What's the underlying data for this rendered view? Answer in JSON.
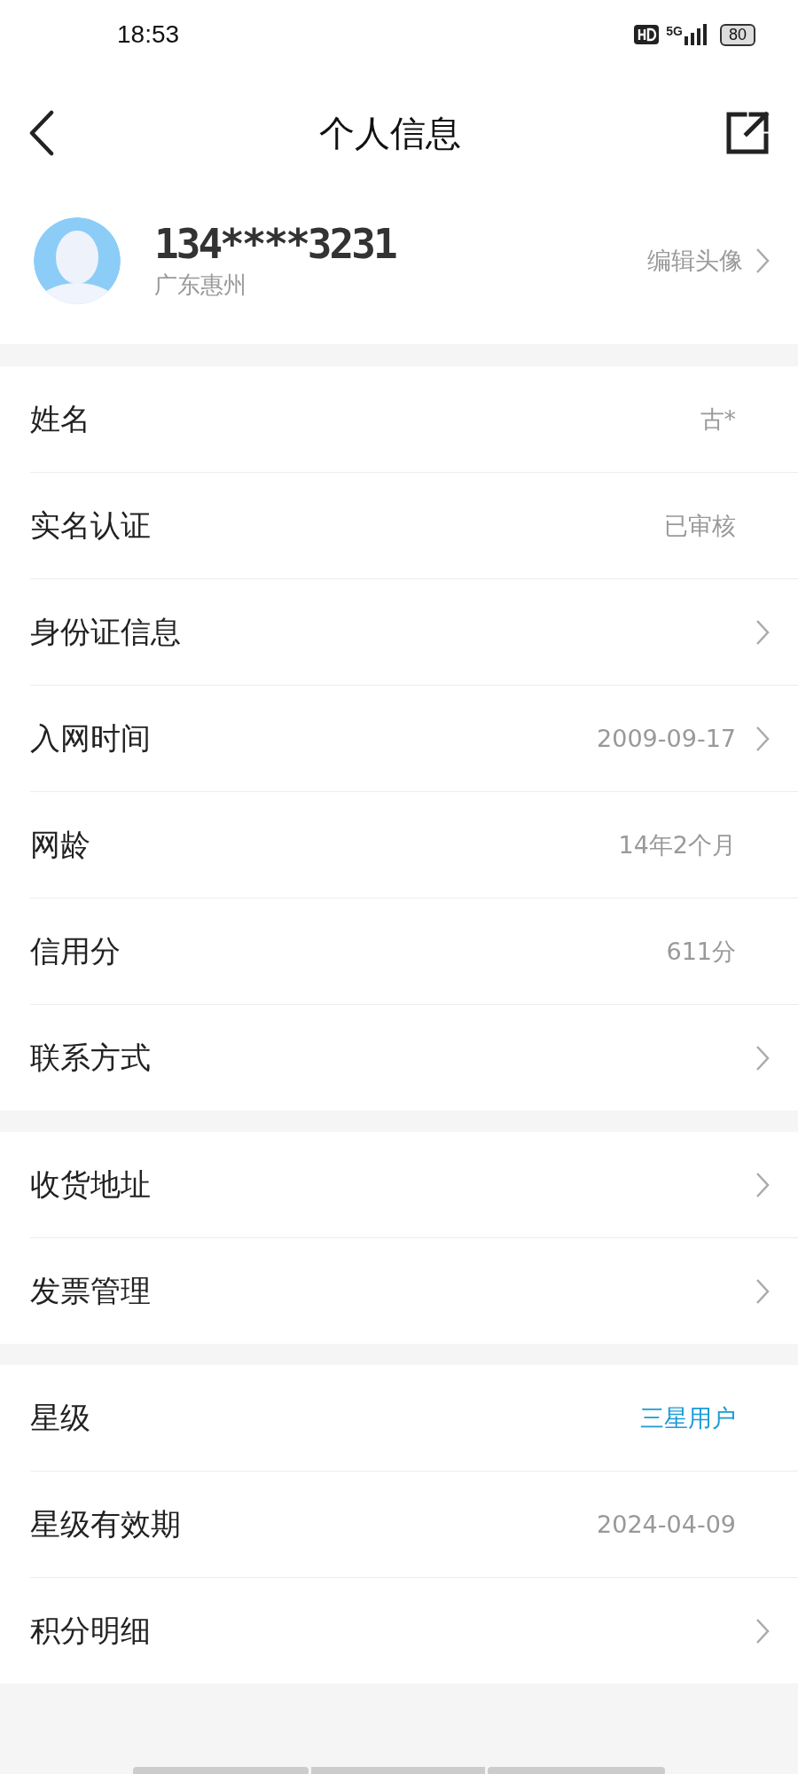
{
  "status_bar": {
    "time": "18:53",
    "network": "5G",
    "battery": "80"
  },
  "header": {
    "title": "个人信息"
  },
  "profile": {
    "phone": "134****3231",
    "location": "广东惠州",
    "edit_label": "编辑头像"
  },
  "sections": [
    {
      "rows": [
        {
          "label": "姓名",
          "value": "古*",
          "chevron": false,
          "accent": false
        },
        {
          "label": "实名认证",
          "value": "已审核",
          "chevron": false,
          "accent": false
        },
        {
          "label": "身份证信息",
          "chevron": true
        },
        {
          "label": "入网时间",
          "value": "2009-09-17",
          "chevron": true,
          "accent": false
        },
        {
          "label": "网龄",
          "value": "14年2个月",
          "chevron": false,
          "accent": false
        },
        {
          "label": "信用分",
          "value": "611分",
          "chevron": false,
          "accent": false
        },
        {
          "label": "联系方式",
          "chevron": true
        }
      ]
    },
    {
      "rows": [
        {
          "label": "收货地址",
          "chevron": true
        },
        {
          "label": "发票管理",
          "chevron": true
        }
      ]
    },
    {
      "rows": [
        {
          "label": "星级",
          "value": "三星用户",
          "chevron": false,
          "accent": true
        },
        {
          "label": "星级有效期",
          "value": "2024-04-09",
          "chevron": false,
          "accent": false
        },
        {
          "label": "积分明细",
          "chevron": true
        }
      ]
    }
  ]
}
